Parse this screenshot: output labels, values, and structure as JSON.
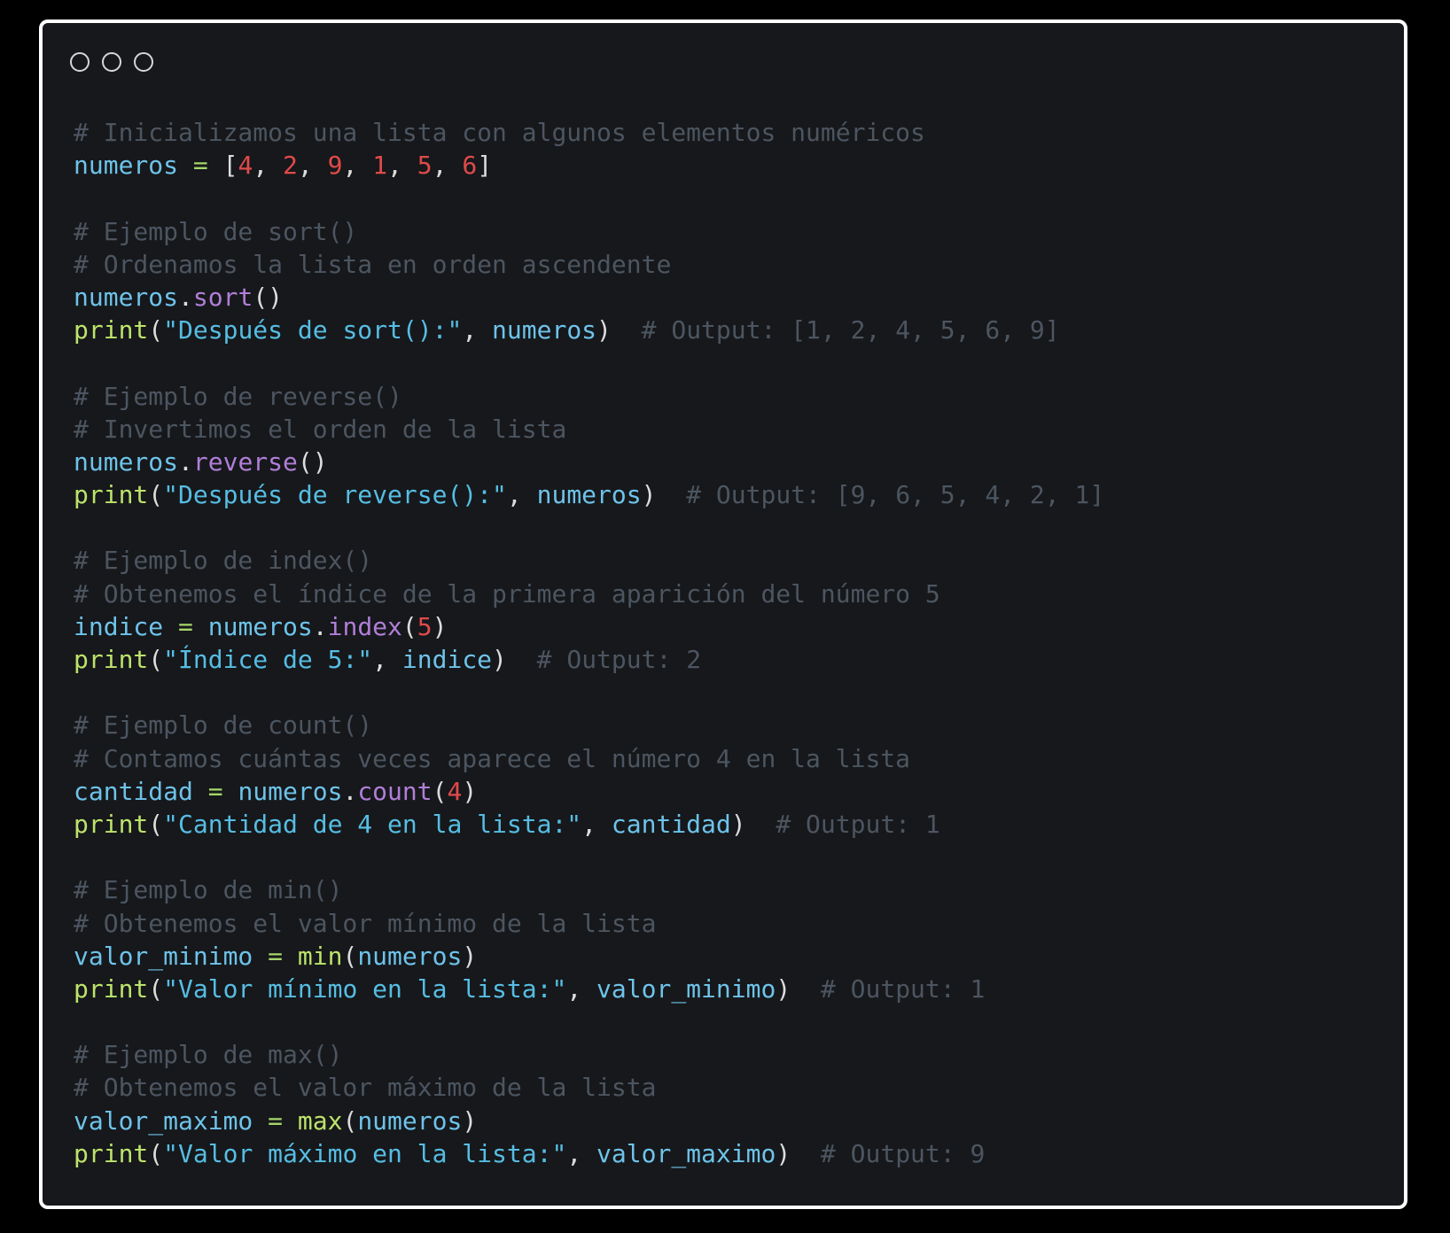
{
  "window": {
    "controls": [
      "window-dot-1",
      "window-dot-2",
      "window-dot-3"
    ]
  },
  "code": {
    "lines": [
      [
        {
          "t": "# Inicializamos una lista con algunos elementos numéricos",
          "c": "cm"
        }
      ],
      [
        {
          "t": "numeros",
          "c": "vr"
        },
        {
          "t": " = ",
          "c": "op"
        },
        {
          "t": "[",
          "c": "pu"
        },
        {
          "t": "4",
          "c": "nm"
        },
        {
          "t": ", ",
          "c": "pu"
        },
        {
          "t": "2",
          "c": "nm"
        },
        {
          "t": ", ",
          "c": "pu"
        },
        {
          "t": "9",
          "c": "nm"
        },
        {
          "t": ", ",
          "c": "pu"
        },
        {
          "t": "1",
          "c": "nm"
        },
        {
          "t": ", ",
          "c": "pu"
        },
        {
          "t": "5",
          "c": "nm"
        },
        {
          "t": ", ",
          "c": "pu"
        },
        {
          "t": "6",
          "c": "nm"
        },
        {
          "t": "]",
          "c": "pu"
        }
      ],
      [],
      [
        {
          "t": "# Ejemplo de sort()",
          "c": "cm"
        }
      ],
      [
        {
          "t": "# Ordenamos la lista en orden ascendente",
          "c": "cm"
        }
      ],
      [
        {
          "t": "numeros",
          "c": "vr"
        },
        {
          "t": ".",
          "c": "pu"
        },
        {
          "t": "sort",
          "c": "mt"
        },
        {
          "t": "()",
          "c": "pu"
        }
      ],
      [
        {
          "t": "print",
          "c": "fn"
        },
        {
          "t": "(",
          "c": "pu"
        },
        {
          "t": "\"Después de sort():\"",
          "c": "st"
        },
        {
          "t": ", ",
          "c": "pu"
        },
        {
          "t": "numeros",
          "c": "vr"
        },
        {
          "t": ")",
          "c": "pu"
        },
        {
          "t": "  # Output: [1, 2, 4, 5, 6, 9]",
          "c": "cm"
        }
      ],
      [],
      [
        {
          "t": "# Ejemplo de reverse()",
          "c": "cm"
        }
      ],
      [
        {
          "t": "# Invertimos el orden de la lista",
          "c": "cm"
        }
      ],
      [
        {
          "t": "numeros",
          "c": "vr"
        },
        {
          "t": ".",
          "c": "pu"
        },
        {
          "t": "reverse",
          "c": "mt"
        },
        {
          "t": "()",
          "c": "pu"
        }
      ],
      [
        {
          "t": "print",
          "c": "fn"
        },
        {
          "t": "(",
          "c": "pu"
        },
        {
          "t": "\"Después de reverse():\"",
          "c": "st"
        },
        {
          "t": ", ",
          "c": "pu"
        },
        {
          "t": "numeros",
          "c": "vr"
        },
        {
          "t": ")",
          "c": "pu"
        },
        {
          "t": "  # Output: [9, 6, 5, 4, 2, 1]",
          "c": "cm"
        }
      ],
      [],
      [
        {
          "t": "# Ejemplo de index()",
          "c": "cm"
        }
      ],
      [
        {
          "t": "# Obtenemos el índice de la primera aparición del número 5",
          "c": "cm"
        }
      ],
      [
        {
          "t": "indice",
          "c": "vr"
        },
        {
          "t": " = ",
          "c": "op"
        },
        {
          "t": "numeros",
          "c": "vr"
        },
        {
          "t": ".",
          "c": "pu"
        },
        {
          "t": "index",
          "c": "mt"
        },
        {
          "t": "(",
          "c": "pu"
        },
        {
          "t": "5",
          "c": "nm"
        },
        {
          "t": ")",
          "c": "pu"
        }
      ],
      [
        {
          "t": "print",
          "c": "fn"
        },
        {
          "t": "(",
          "c": "pu"
        },
        {
          "t": "\"Índice de 5:\"",
          "c": "st"
        },
        {
          "t": ", ",
          "c": "pu"
        },
        {
          "t": "indice",
          "c": "vr"
        },
        {
          "t": ")",
          "c": "pu"
        },
        {
          "t": "  # Output: 2",
          "c": "cm"
        }
      ],
      [],
      [
        {
          "t": "# Ejemplo de count()",
          "c": "cm"
        }
      ],
      [
        {
          "t": "# Contamos cuántas veces aparece el número 4 en la lista",
          "c": "cm"
        }
      ],
      [
        {
          "t": "cantidad",
          "c": "vr"
        },
        {
          "t": " = ",
          "c": "op"
        },
        {
          "t": "numeros",
          "c": "vr"
        },
        {
          "t": ".",
          "c": "pu"
        },
        {
          "t": "count",
          "c": "mt"
        },
        {
          "t": "(",
          "c": "pu"
        },
        {
          "t": "4",
          "c": "nm"
        },
        {
          "t": ")",
          "c": "pu"
        }
      ],
      [
        {
          "t": "print",
          "c": "fn"
        },
        {
          "t": "(",
          "c": "pu"
        },
        {
          "t": "\"Cantidad de 4 en la lista:\"",
          "c": "st"
        },
        {
          "t": ", ",
          "c": "pu"
        },
        {
          "t": "cantidad",
          "c": "vr"
        },
        {
          "t": ")",
          "c": "pu"
        },
        {
          "t": "  # Output: 1",
          "c": "cm"
        }
      ],
      [],
      [
        {
          "t": "# Ejemplo de min()",
          "c": "cm"
        }
      ],
      [
        {
          "t": "# Obtenemos el valor mínimo de la lista",
          "c": "cm"
        }
      ],
      [
        {
          "t": "valor_minimo",
          "c": "vr"
        },
        {
          "t": " = ",
          "c": "op"
        },
        {
          "t": "min",
          "c": "fn"
        },
        {
          "t": "(",
          "c": "pu"
        },
        {
          "t": "numeros",
          "c": "vr"
        },
        {
          "t": ")",
          "c": "pu"
        }
      ],
      [
        {
          "t": "print",
          "c": "fn"
        },
        {
          "t": "(",
          "c": "pu"
        },
        {
          "t": "\"Valor mínimo en la lista:\"",
          "c": "st"
        },
        {
          "t": ", ",
          "c": "pu"
        },
        {
          "t": "valor_minimo",
          "c": "vr"
        },
        {
          "t": ")",
          "c": "pu"
        },
        {
          "t": "  # Output: 1",
          "c": "cm"
        }
      ],
      [],
      [
        {
          "t": "# Ejemplo de max()",
          "c": "cm"
        }
      ],
      [
        {
          "t": "# Obtenemos el valor máximo de la lista",
          "c": "cm"
        }
      ],
      [
        {
          "t": "valor_maximo",
          "c": "vr"
        },
        {
          "t": " = ",
          "c": "op"
        },
        {
          "t": "max",
          "c": "fn"
        },
        {
          "t": "(",
          "c": "pu"
        },
        {
          "t": "numeros",
          "c": "vr"
        },
        {
          "t": ")",
          "c": "pu"
        }
      ],
      [
        {
          "t": "print",
          "c": "fn"
        },
        {
          "t": "(",
          "c": "pu"
        },
        {
          "t": "\"Valor máximo en la lista:\"",
          "c": "st"
        },
        {
          "t": ", ",
          "c": "pu"
        },
        {
          "t": "valor_maximo",
          "c": "vr"
        },
        {
          "t": ")",
          "c": "pu"
        },
        {
          "t": "  # Output: 9",
          "c": "cm"
        }
      ]
    ]
  },
  "colors": {
    "background": "#16181b",
    "frame": "#ffffff",
    "comment": "#4c5560",
    "variable": "#6ec3ea",
    "operator": "#a5d66a",
    "number": "#e04a4a",
    "method": "#b17ed8",
    "function": "#bde36b",
    "string": "#56bde3"
  }
}
